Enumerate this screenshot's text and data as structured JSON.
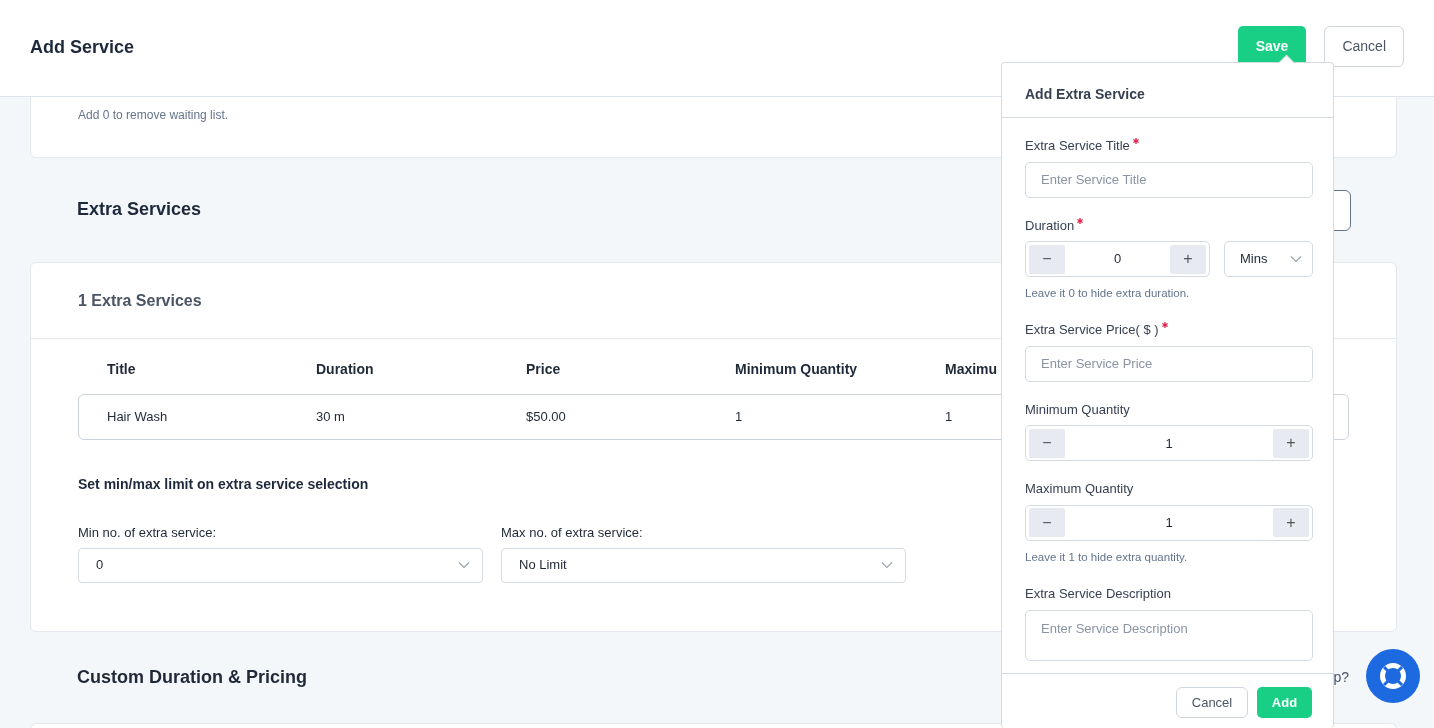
{
  "header": {
    "title": "Add Service",
    "buttons": [
      {
        "label": "Save",
        "kind": "primary"
      },
      {
        "label": "Cancel",
        "kind": "secondary"
      }
    ]
  },
  "waiting_list": {
    "help": "Add 0 to remove waiting list."
  },
  "extra_services": {
    "heading": "Extra Services",
    "count_title": "1 Extra Services",
    "columns": [
      "Title",
      "Duration",
      "Price",
      "Minimum Quantity",
      "Maximu"
    ],
    "rows": [
      [
        "Hair Wash",
        "30 m",
        "$50.00",
        "1",
        "1"
      ]
    ],
    "limit_title": "Set min/max limit on extra service selection",
    "limits": [
      {
        "label": "Min no. of extra service:",
        "value": "0"
      },
      {
        "label": "Max no. of extra service:",
        "value": "No Limit"
      }
    ]
  },
  "custom_pricing": {
    "heading": "Custom Duration & Pricing",
    "aside": "p?"
  },
  "popover": {
    "title": "Add Extra Service",
    "fields": [
      {
        "kind": "text",
        "label": "Extra Service Title",
        "required": true,
        "placeholder": "Enter Service Title"
      },
      {
        "kind": "stepper",
        "label": "Duration",
        "required": true,
        "decrement": "−",
        "value": "0",
        "increment": "+",
        "unit": "Mins",
        "hint": "Leave it 0 to hide extra duration."
      },
      {
        "kind": "text",
        "label": "Extra Service Price( $ )",
        "required": true,
        "placeholder": "Enter Service Price"
      },
      {
        "kind": "stepper",
        "label": "Minimum Quantity",
        "required": false,
        "decrement": "−",
        "value": "1",
        "increment": "+"
      },
      {
        "kind": "stepper",
        "label": "Maximum Quantity",
        "required": false,
        "decrement": "−",
        "value": "1",
        "increment": "+",
        "hint": "Leave it 1 to hide extra quantity."
      },
      {
        "kind": "textarea",
        "label": "Extra Service Description",
        "required": false,
        "placeholder": "Enter Service Description"
      }
    ],
    "buttons": [
      {
        "label": "Cancel",
        "kind": "secondary"
      },
      {
        "label": "Add",
        "kind": "primary"
      }
    ]
  }
}
